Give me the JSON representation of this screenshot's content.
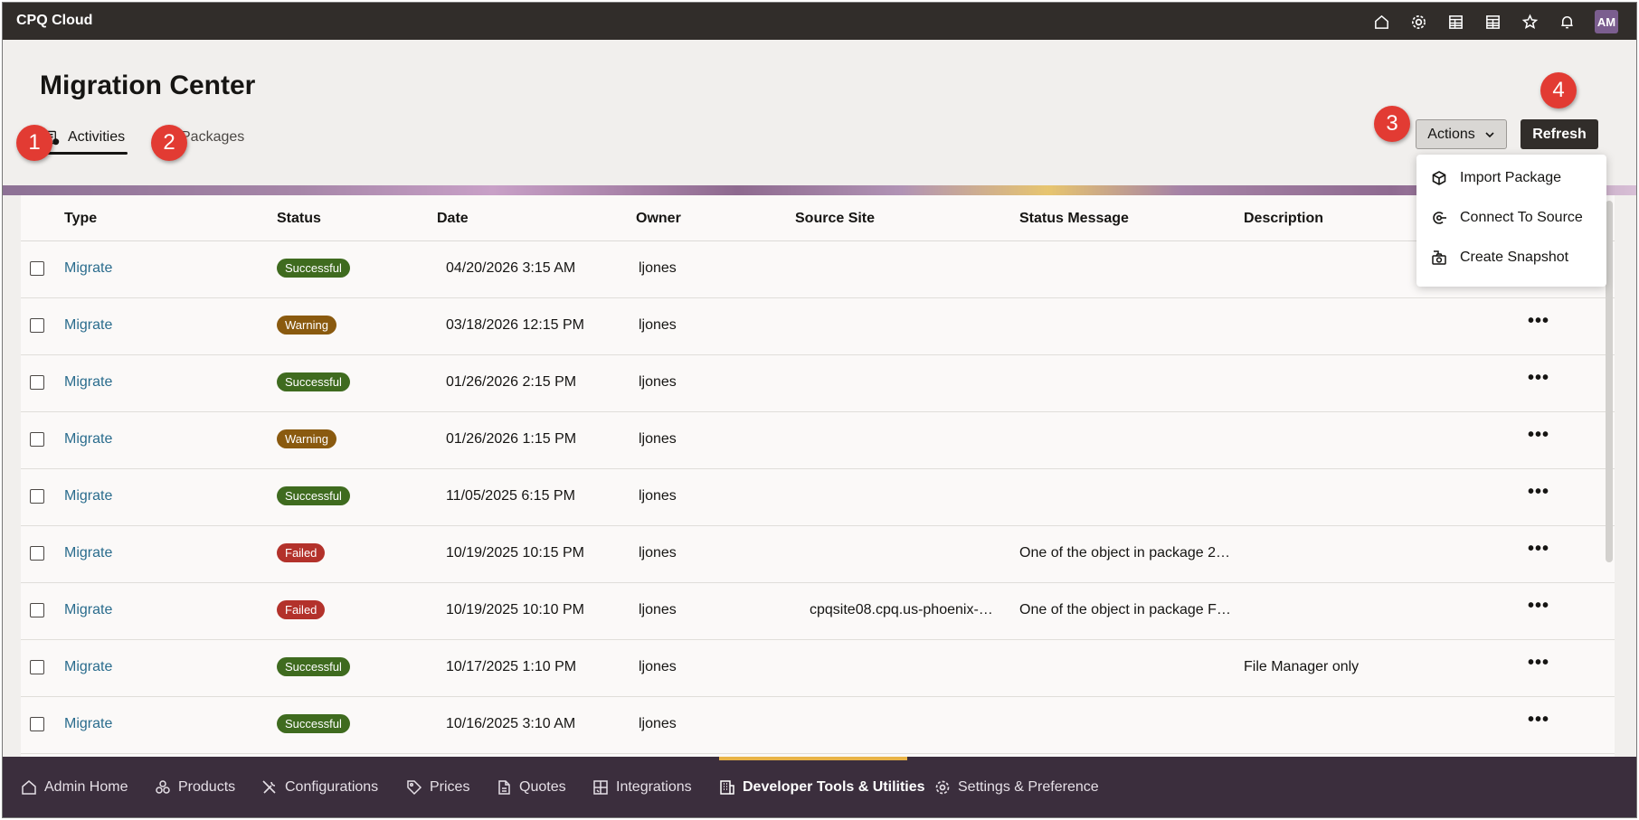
{
  "app": {
    "title": "CPQ Cloud",
    "avatar": "AM"
  },
  "page": {
    "title": "Migration Center",
    "tabs": [
      {
        "label": "Activities",
        "icon": "activities-icon",
        "selected": true
      },
      {
        "label": "Packages",
        "icon": "package-icon",
        "selected": false
      }
    ],
    "actions_label": "Actions",
    "refresh_label": "Refresh"
  },
  "callouts": [
    "1",
    "2",
    "3",
    "4"
  ],
  "actions_menu": [
    {
      "label": "Import Package",
      "icon": "package-icon"
    },
    {
      "label": "Connect To Source",
      "icon": "connect-icon"
    },
    {
      "label": "Create Snapshot",
      "icon": "snapshot-icon"
    }
  ],
  "table": {
    "columns": [
      "Type",
      "Status",
      "Date",
      "Owner",
      "Source Site",
      "Status Message",
      "Description"
    ],
    "rows": [
      {
        "type": "Migrate",
        "status": "Successful",
        "date": "04/20/2026 3:15 AM",
        "owner": "ljones",
        "source": "",
        "message": "",
        "description": ""
      },
      {
        "type": "Migrate",
        "status": "Warning",
        "date": "03/18/2026 12:15 PM",
        "owner": "ljones",
        "source": "",
        "message": "",
        "description": ""
      },
      {
        "type": "Migrate",
        "status": "Successful",
        "date": "01/26/2026 2:15 PM",
        "owner": "ljones",
        "source": "",
        "message": "",
        "description": ""
      },
      {
        "type": "Migrate",
        "status": "Warning",
        "date": "01/26/2026 1:15 PM",
        "owner": "ljones",
        "source": "",
        "message": "",
        "description": ""
      },
      {
        "type": "Migrate",
        "status": "Successful",
        "date": "11/05/2025 6:15 PM",
        "owner": "ljones",
        "source": "",
        "message": "",
        "description": ""
      },
      {
        "type": "Migrate",
        "status": "Failed",
        "date": "10/19/2025 10:15 PM",
        "owner": "ljones",
        "source": "",
        "message": "One of the object in package 2…",
        "description": ""
      },
      {
        "type": "Migrate",
        "status": "Failed",
        "date": "10/19/2025 10:10 PM",
        "owner": "ljones",
        "source": "cpqsite08.cpq.us-phoenix-…",
        "message": "One of the object in package F…",
        "description": ""
      },
      {
        "type": "Migrate",
        "status": "Successful",
        "date": "10/17/2025 1:10 PM",
        "owner": "ljones",
        "source": "",
        "message": "",
        "description": "File Manager only"
      },
      {
        "type": "Migrate",
        "status": "Successful",
        "date": "10/16/2025 3:10 AM",
        "owner": "ljones",
        "source": "",
        "message": "",
        "description": ""
      }
    ]
  },
  "status_colors": {
    "Successful": "#3f6b1f",
    "Warning": "#8a5a0f",
    "Failed": "#b3322b"
  },
  "bottom_nav": [
    {
      "label": "Admin Home",
      "icon": "home-icon",
      "active": false
    },
    {
      "label": "Products",
      "icon": "products-icon",
      "active": false
    },
    {
      "label": "Configurations",
      "icon": "tools-icon",
      "active": false
    },
    {
      "label": "Prices",
      "icon": "price-tag-icon",
      "active": false
    },
    {
      "label": "Quotes",
      "icon": "document-icon",
      "active": false
    },
    {
      "label": "Integrations",
      "icon": "integrations-icon",
      "active": false
    },
    {
      "label": "Developer Tools & Utilities",
      "icon": "building-icon",
      "active": true
    },
    {
      "label": "Settings & Preference",
      "icon": "gear-icon",
      "active": false
    }
  ]
}
